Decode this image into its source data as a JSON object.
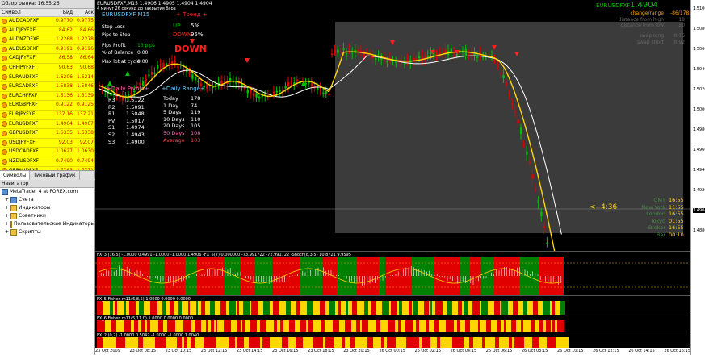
{
  "market_watch": {
    "title": "Обзор рынка: 16:55:26",
    "headers": {
      "symbol": "Символ",
      "bid": "Бид",
      "ask": "Аск"
    },
    "rows": [
      {
        "symbol": "AUDCADFXF",
        "bid": "0.9770",
        "ask": "0.9775"
      },
      {
        "symbol": "AUDJPYFXF",
        "bid": "84.62",
        "ask": "84.66"
      },
      {
        "symbol": "AUDNZDFXF",
        "bid": "1.2268",
        "ask": "1.2278"
      },
      {
        "symbol": "AUDUSDFXF",
        "bid": "0.9191",
        "ask": "0.9196"
      },
      {
        "symbol": "CADJPYFXF",
        "bid": "86.58",
        "ask": "86.64"
      },
      {
        "symbol": "CHFJPYFXF",
        "bid": "90.63",
        "ask": "90.68"
      },
      {
        "symbol": "EURAUDFXF",
        "bid": "1.6206",
        "ask": "1.6214"
      },
      {
        "symbol": "EURCADFXF",
        "bid": "1.5838",
        "ask": "1.5846"
      },
      {
        "symbol": "EURCHFFXF",
        "bid": "1.5136",
        "ask": "1.5139"
      },
      {
        "symbol": "EURGBPFXF",
        "bid": "0.9122",
        "ask": "0.9125"
      },
      {
        "symbol": "EURJPYFXF",
        "bid": "137.16",
        "ask": "137.21"
      },
      {
        "symbol": "EURUSDFXF",
        "bid": "1.4904",
        "ask": "1.4907"
      },
      {
        "symbol": "GBPUSDFXF",
        "bid": "1.6335",
        "ask": "1.6338"
      },
      {
        "symbol": "USDJPYFXF",
        "bid": "92.03",
        "ask": "92.07"
      },
      {
        "symbol": "USDCADFXF",
        "bid": "1.0627",
        "ask": "1.0630"
      },
      {
        "symbol": "NZDUSDFXF",
        "bid": "0.7490",
        "ask": "0.7494"
      },
      {
        "symbol": "GBPAUDFXF",
        "bid": "1.7763",
        "ask": "1.7771"
      },
      {
        "symbol": "GBPCADFXF",
        "bid": "1.7358",
        "ask": "1.7367"
      },
      {
        "symbol": "GBPCHFFXF",
        "bid": "1.6589",
        "ask": "1.6595"
      }
    ],
    "tabs": [
      "Символы",
      "Тиковый график"
    ]
  },
  "navigator": {
    "title": "Навигатор",
    "items": [
      "MetaTrader 4 at FOREX.com",
      "Счета",
      "Индикаторы",
      "Советники",
      "Пользовательские Индикаторы",
      "Скрипты"
    ]
  },
  "chart": {
    "header": "EURUSDFXF,M15  1.4906 1.4905 1.4904 1.4904",
    "sub_header": "4 минут 26 секунд до закрытия бара",
    "symbol_panel": "EURUSDFXF  M15",
    "trend_label": "+ Тренд +",
    "up_label": "UP",
    "up_value": "5%",
    "down_label": "DOWN",
    "down_value": "95%",
    "stop_loss": "Stop Loss",
    "pips_to_stop": "Pips to Stop",
    "pips_profit": "Pips Profit",
    "pips_profit_value": "13 pips",
    "pct_balance": "% of Balance",
    "pct_balance_value": "0.00",
    "max_lot": "Max lot at cycle",
    "max_lot_value": "0.00",
    "big_down": "DOWN",
    "pivots_title": "+Daily Pivots+",
    "pivots": [
      {
        "label": "R3",
        "value": "1.5122"
      },
      {
        "label": "R2",
        "value": "1.5091"
      },
      {
        "label": "R1",
        "value": "1.5048"
      },
      {
        "label": "PV",
        "value": "1.5017"
      },
      {
        "label": "S1",
        "value": "1.4974"
      },
      {
        "label": "S2",
        "value": "1.4943"
      },
      {
        "label": "S3",
        "value": "1.4900"
      }
    ],
    "range_title": "+Daily Range+",
    "ranges": [
      {
        "label": "Today",
        "value": "178"
      },
      {
        "label": "1 Day",
        "value": "74"
      },
      {
        "label": "5 Days",
        "value": "119"
      },
      {
        "label": "10 Days",
        "value": "110"
      },
      {
        "label": "20 Days",
        "value": "105"
      },
      {
        "label": "50 Days",
        "value": "108"
      },
      {
        "label": "Average",
        "value": "103"
      }
    ],
    "right_price": "1.4904",
    "right_symbol": "EURUSDFXF",
    "change_label": "change/range",
    "change_value": "-86/178",
    "dist_high_label": "distance from high",
    "dist_high_value": "18",
    "dist_low_label": "distance from low",
    "dist_low_value": "20",
    "swap_long_label": "swap long",
    "swap_long_value": "0.76",
    "swap_short_label": "swap short",
    "swap_short_value": "0.92",
    "countdown": "<--4:36",
    "clocks": [
      {
        "label": "GMT",
        "value": "16:55"
      },
      {
        "label": "New York",
        "value": "11:55"
      },
      {
        "label": "London",
        "value": "16:55"
      },
      {
        "label": "Tokyo",
        "value": "01:55"
      },
      {
        "label": "Broker",
        "value": "16:55"
      },
      {
        "label": "Bar",
        "value": "00:10"
      }
    ],
    "colors": {
      "bull": "#00c000",
      "bear": "#e00000",
      "ma_fast": "#ffd700",
      "ma_slow": "#ffffff",
      "grey_box": "#3b3b3b"
    }
  },
  "price_axis": [
    "1.5100",
    "1.5080",
    "1.5060",
    "1.5040",
    "1.5020",
    "1.5000",
    "1.4980",
    "1.4960",
    "1.4940",
    "1.4920",
    "1.4904",
    "1.4880"
  ],
  "panes": [
    {
      "label": "FX_3 (16,5) -1.0000 0.4991 -1.0000 -1.0000 1.4906 -FX_5(7) 0.000000 -73.991722 -72.991722 -Snoch(8,3,5) 10.8721 9.9595"
    },
    {
      "label": "FX_5 Fisher_m11(6,8,5) 1.0000 0.0000 0.0000"
    },
    {
      "label": "FX_6 Fisher_m11(5,11,0) 1.0000 0.0000 0.0000"
    },
    {
      "label": "FX_2 (0,2) -1.0000 0.5042 -1.0000 -1.0000 1.0040"
    }
  ],
  "time_axis": [
    "23 Oct 2009",
    "23 Oct 08:15",
    "23 Oct 10:15",
    "23 Oct 12:15",
    "23 Oct 14:15",
    "23 Oct 16:15",
    "23 Oct 18:15",
    "23 Oct 20:15",
    "26 Oct 00:15",
    "26 Oct 02:15",
    "26 Oct 04:15",
    "26 Oct 06:15",
    "26 Oct 08:15",
    "26 Oct 10:15",
    "26 Oct 12:15",
    "26 Oct 14:15",
    "26 Oct 16:15"
  ]
}
